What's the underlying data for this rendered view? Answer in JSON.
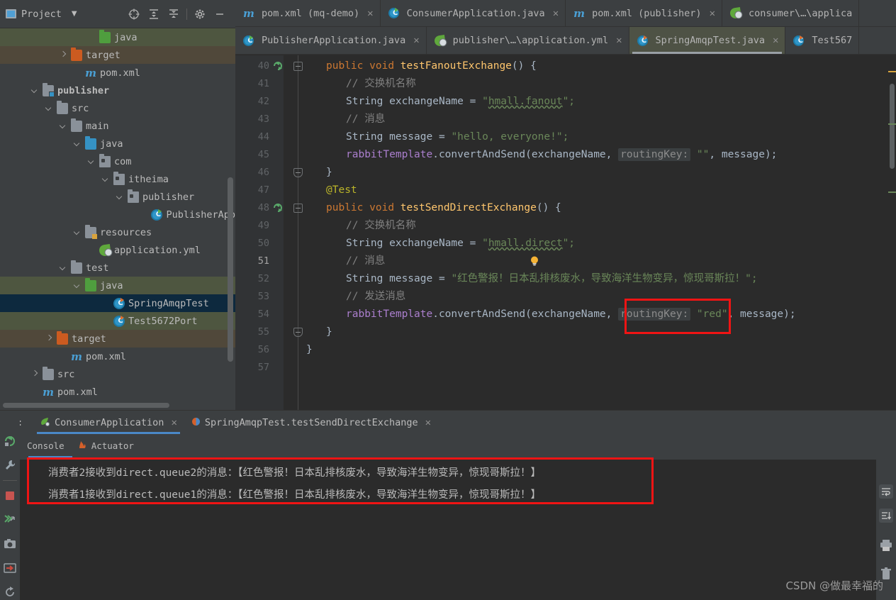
{
  "project_panel": {
    "title": "Project",
    "icons": [
      "project-window-icon",
      "dropdown-caret-icon",
      "locate-icon",
      "expand-all-icon",
      "collapse-all-icon",
      "settings-gear-icon",
      "hide-icon"
    ],
    "tree": [
      {
        "label": "java",
        "indent": 6,
        "icon": "folder-green",
        "arrow": "none",
        "highlight": "green",
        "bold": false
      },
      {
        "label": "target",
        "indent": 4,
        "icon": "folder-orange",
        "arrow": "right",
        "highlight": "brown",
        "bold": false
      },
      {
        "label": "pom.xml",
        "indent": 5,
        "icon": "maven",
        "arrow": "none",
        "highlight": "none",
        "bold": false
      },
      {
        "label": "publisher",
        "indent": 2,
        "icon": "folder-module",
        "arrow": "down",
        "highlight": "none",
        "bold": true
      },
      {
        "label": "src",
        "indent": 3,
        "icon": "folder-gray",
        "arrow": "down",
        "highlight": "none",
        "bold": false
      },
      {
        "label": "main",
        "indent": 4,
        "icon": "folder-gray",
        "arrow": "down",
        "highlight": "none",
        "bold": false
      },
      {
        "label": "java",
        "indent": 5,
        "icon": "folder-blue",
        "arrow": "down",
        "highlight": "none",
        "bold": false
      },
      {
        "label": "com",
        "indent": 6,
        "icon": "package",
        "arrow": "down",
        "highlight": "none",
        "bold": false
      },
      {
        "label": "itheima",
        "indent": 7,
        "icon": "package",
        "arrow": "down",
        "highlight": "none",
        "bold": false
      },
      {
        "label": "publisher",
        "indent": 8,
        "icon": "package",
        "arrow": "down",
        "highlight": "none",
        "bold": false
      },
      {
        "label": "PublisherApp",
        "indent": 10,
        "icon": "spring-class",
        "arrow": "none",
        "highlight": "none",
        "bold": false
      },
      {
        "label": "resources",
        "indent": 5,
        "icon": "folder-res",
        "arrow": "down",
        "highlight": "none",
        "bold": false
      },
      {
        "label": "application.yml",
        "indent": 6,
        "icon": "yml",
        "arrow": "none",
        "highlight": "none",
        "bold": false
      },
      {
        "label": "test",
        "indent": 4,
        "icon": "folder-gray",
        "arrow": "down",
        "highlight": "none",
        "bold": false
      },
      {
        "label": "java",
        "indent": 5,
        "icon": "folder-green",
        "arrow": "down",
        "highlight": "green",
        "bold": false
      },
      {
        "label": "SpringAmqpTest",
        "indent": 7,
        "icon": "test-class",
        "arrow": "none",
        "highlight": "blue",
        "bold": false
      },
      {
        "label": "Test5672Port",
        "indent": 7,
        "icon": "test-class",
        "arrow": "none",
        "highlight": "green",
        "bold": false
      },
      {
        "label": "target",
        "indent": 3,
        "icon": "folder-orange",
        "arrow": "right",
        "highlight": "brown",
        "bold": false
      },
      {
        "label": "pom.xml",
        "indent": 4,
        "icon": "maven",
        "arrow": "none",
        "highlight": "none",
        "bold": false
      },
      {
        "label": "src",
        "indent": 2,
        "icon": "folder-gray",
        "arrow": "right",
        "highlight": "none",
        "bold": false
      },
      {
        "label": "pom.xml",
        "indent": 2,
        "icon": "maven",
        "arrow": "none",
        "highlight": "none",
        "bold": false
      }
    ]
  },
  "editor": {
    "tabs_row1": [
      {
        "label": "pom.xml (mq-demo)",
        "icon": "maven-icon",
        "active": false,
        "close": true
      },
      {
        "label": "ConsumerApplication.java",
        "icon": "spring-class-icon",
        "active": false,
        "close": true
      },
      {
        "label": "pom.xml (publisher)",
        "icon": "maven-icon",
        "active": false,
        "close": true
      },
      {
        "label": "consumer\\…\\applica",
        "icon": "yml-icon",
        "active": false,
        "close": false
      }
    ],
    "tabs_row2": [
      {
        "label": "PublisherApplication.java",
        "icon": "spring-class-icon",
        "active": false,
        "close": true
      },
      {
        "label": "publisher\\…\\application.yml",
        "icon": "yml-icon",
        "active": false,
        "close": true
      },
      {
        "label": "SpringAmqpTest.java",
        "icon": "test-class-icon",
        "active": true,
        "close": true
      },
      {
        "label": "Test567",
        "icon": "test-class-icon",
        "active": false,
        "close": false
      }
    ],
    "first_line_number": 40,
    "current_line": 51,
    "lines": [
      {
        "n": 40,
        "indent": 1,
        "tokens": [
          {
            "t": "public",
            "c": "kw"
          },
          {
            "t": " ",
            "c": "id"
          },
          {
            "t": "void",
            "c": "kw"
          },
          {
            "t": " ",
            "c": "id"
          },
          {
            "t": "testFanoutExchange",
            "c": "kw2"
          },
          {
            "t": "() {",
            "c": "id"
          }
        ],
        "run": true,
        "fold": "start"
      },
      {
        "n": 41,
        "indent": 2,
        "tokens": [
          {
            "t": "// 交换机名称",
            "c": "cmt"
          }
        ]
      },
      {
        "n": 42,
        "indent": 2,
        "tokens": [
          {
            "t": "String",
            "c": "id"
          },
          {
            "t": " exchangeName ",
            "c": "id"
          },
          {
            "t": "= ",
            "c": "id"
          },
          {
            "t": "\"",
            "c": "str"
          },
          {
            "t": "hmall.fanout",
            "c": "str wavy"
          },
          {
            "t": "\";",
            "c": "str"
          }
        ]
      },
      {
        "n": 43,
        "indent": 2,
        "tokens": [
          {
            "t": "// 消息",
            "c": "cmt"
          }
        ]
      },
      {
        "n": 44,
        "indent": 2,
        "tokens": [
          {
            "t": "String",
            "c": "id"
          },
          {
            "t": " message ",
            "c": "id"
          },
          {
            "t": "= ",
            "c": "id"
          },
          {
            "t": "\"hello, everyone!\"",
            "c": "str"
          },
          {
            "t": ";",
            "c": "str"
          }
        ]
      },
      {
        "n": 45,
        "indent": 2,
        "tokens": [
          {
            "t": "rabbitTemplate",
            "c": "mth"
          },
          {
            "t": ".convertAndSend",
            "c": "id"
          },
          {
            "t": "(",
            "c": "id"
          },
          {
            "t": "exchangeName",
            "c": "id"
          },
          {
            "t": ", ",
            "c": "id"
          },
          {
            "t": "routingKey:",
            "c": "hintparam"
          },
          {
            "t": " ",
            "c": "id"
          },
          {
            "t": "\"\"",
            "c": "str"
          },
          {
            "t": ", ",
            "c": "id"
          },
          {
            "t": "message",
            "c": "id"
          },
          {
            "t": ");",
            "c": "id"
          }
        ]
      },
      {
        "n": 46,
        "indent": 1,
        "tokens": [
          {
            "t": "}",
            "c": "id"
          }
        ],
        "fold": "end"
      },
      {
        "n": 47,
        "indent": 1,
        "tokens": [
          {
            "t": "@Test",
            "c": "ann"
          }
        ]
      },
      {
        "n": 48,
        "indent": 1,
        "tokens": [
          {
            "t": "public",
            "c": "kw"
          },
          {
            "t": " ",
            "c": "id"
          },
          {
            "t": "void",
            "c": "kw"
          },
          {
            "t": " ",
            "c": "id"
          },
          {
            "t": "testSendDirectExchange",
            "c": "kw2"
          },
          {
            "t": "() {",
            "c": "id"
          }
        ],
        "run": true,
        "fold": "start"
      },
      {
        "n": 49,
        "indent": 2,
        "tokens": [
          {
            "t": "// 交换机名称",
            "c": "cmt"
          }
        ]
      },
      {
        "n": 50,
        "indent": 2,
        "tokens": [
          {
            "t": "String",
            "c": "id"
          },
          {
            "t": " exchangeName ",
            "c": "id"
          },
          {
            "t": "= ",
            "c": "id"
          },
          {
            "t": "\"",
            "c": "str"
          },
          {
            "t": "hmall.direct",
            "c": "str wavy"
          },
          {
            "t": "\";",
            "c": "str"
          }
        ]
      },
      {
        "n": 51,
        "indent": 2,
        "tokens": [
          {
            "t": "// 消息",
            "c": "cmt"
          }
        ],
        "bulb": true
      },
      {
        "n": 52,
        "indent": 2,
        "tokens": [
          {
            "t": "String",
            "c": "id"
          },
          {
            "t": " message ",
            "c": "id"
          },
          {
            "t": "= ",
            "c": "id"
          },
          {
            "t": "\"红色警报！日本乱排核废水，导致海洋生物变异，惊现哥斯拉！\"",
            "c": "str"
          },
          {
            "t": ";",
            "c": "str"
          }
        ]
      },
      {
        "n": 53,
        "indent": 2,
        "tokens": [
          {
            "t": "// 发送消息",
            "c": "cmt"
          }
        ]
      },
      {
        "n": 54,
        "indent": 2,
        "tokens": [
          {
            "t": "rabbitTemplate",
            "c": "mth"
          },
          {
            "t": ".convertAndSend",
            "c": "id"
          },
          {
            "t": "(",
            "c": "id"
          },
          {
            "t": "exchangeName",
            "c": "id"
          },
          {
            "t": ", ",
            "c": "id"
          },
          {
            "t": "routingKey:",
            "c": "hintparam"
          },
          {
            "t": " ",
            "c": "id"
          },
          {
            "t": "\"red\"",
            "c": "str"
          },
          {
            "t": ", ",
            "c": "id"
          },
          {
            "t": "message",
            "c": "id"
          },
          {
            "t": ");",
            "c": "id"
          }
        ]
      },
      {
        "n": 55,
        "indent": 1,
        "tokens": [
          {
            "t": "}",
            "c": "id"
          }
        ],
        "fold": "end"
      },
      {
        "n": 56,
        "indent": 0,
        "tokens": [
          {
            "t": "}",
            "c": "id"
          }
        ]
      },
      {
        "n": 57,
        "indent": 0,
        "tokens": []
      }
    ],
    "annotation_box_label": "routingKey-red-highlight"
  },
  "run_panel": {
    "run_label": "Run:",
    "tabs": [
      {
        "label": "ConsumerApplication",
        "icon": "spring-boot-icon",
        "active": true,
        "close": true
      },
      {
        "label": "SpringAmqpTest.testSendDirectExchange",
        "icon": "junit-icon",
        "active": false,
        "close": true
      }
    ],
    "sub_tabs": [
      {
        "label": "Console",
        "icon": "console-icon"
      },
      {
        "label": "Actuator",
        "icon": "actuator-icon"
      }
    ],
    "console_lines": [
      "消费者2接收到direct.queue2的消息：【红色警报！日本乱排核废水，导致海洋生物变异，惊现哥斯拉！】",
      "消费者1接收到direct.queue1的消息：【红色警报！日本乱排核废水，导致海洋生物变异，惊现哥斯拉！】"
    ],
    "left_tool_icons": [
      "rerun-icon",
      "wrench-icon",
      "stop-icon",
      "thread-dump-icon",
      "camera-icon",
      "export-icon",
      "restore-icon"
    ],
    "right_tool_icons": [
      "soft-wrap-icon",
      "scroll-to-end-icon",
      "print-icon",
      "clear-all-icon"
    ],
    "console_highlight": "console-red-box"
  },
  "watermark": "CSDN @做最幸福的",
  "colors": {
    "panel_bg": "#3c3f41",
    "editor_bg": "#2b2b2b",
    "gutter_bg": "#313335",
    "accent_blue": "#4a88c7",
    "highlight_red": "#f01414",
    "selection_blue": "#0d293e",
    "selection_green": "#4e5640",
    "selection_brown": "#50483a",
    "tab_active": "#4e5245"
  }
}
